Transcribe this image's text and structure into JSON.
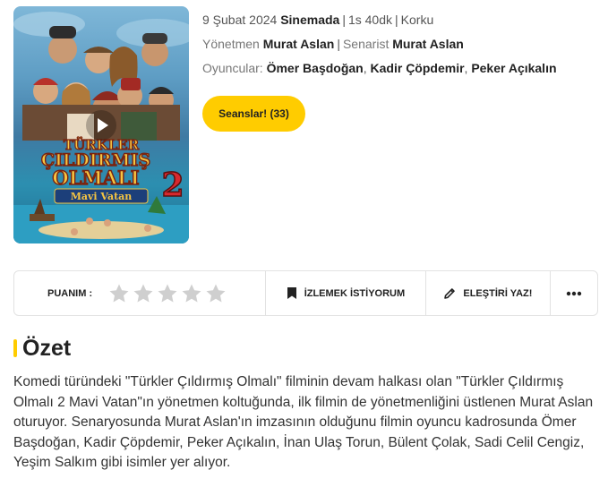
{
  "poster": {
    "title_line1": "TÜRKLER",
    "title_line2": "ÇILDIRMIŞ",
    "title_line3": "OLMALI",
    "title_number": "2",
    "subtitle": "Mavi Vatan",
    "icon": "play-icon"
  },
  "info": {
    "date": "9 Şubat 2024",
    "status": "Sinemada",
    "duration": "1s 40dk",
    "genre": "Korku",
    "director_label": "Yönetmen",
    "director": "Murat Aslan",
    "writer_label": "Senarist",
    "writer": "Murat Aslan",
    "cast_label": "Oyuncular:",
    "cast": [
      "Ömer Başdoğan",
      "Kadir Çöpdemir",
      "Peker Açıkalın"
    ]
  },
  "actions": {
    "seanslar_label": "Seanslar! (33)",
    "rating_label": "PUANIM :",
    "rating_stars": 5,
    "rating_value": 0,
    "watchlist_label": "İZLEMEK İSTİYORUM",
    "review_label": "ELEŞTİRİ YAZ!",
    "more_icon": "more-dots-icon"
  },
  "summary": {
    "title": "Özet",
    "text": "Komedi türündeki \"Türkler Çıldırmış Olmalı\" filminin devam halkası olan \"Türkler Çıldırmış Olmalı 2 Mavi Vatan\"ın yönetmen koltuğunda, ilk filmin de yönetmenliğini üstlenen Murat Aslan oturuyor. Senaryosunda Murat Aslan'ın imzasının olduğunu filmin oyuncu kadrosunda Ömer Başdoğan, Kadir Çöpdemir, Peker Açıkalın, İnan Ulaş Torun, Bülent Çolak, Sadi Celil Cengiz, Yeşim Salkım gibi isimler yer alıyor."
  },
  "colors": {
    "accent": "#ffcc00",
    "star": "#cfcfcf",
    "border": "#e2e2e2"
  }
}
